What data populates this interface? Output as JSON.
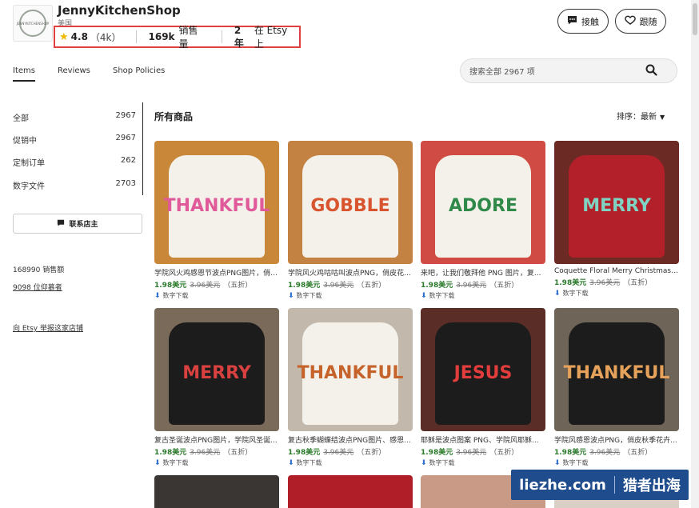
{
  "shop": {
    "name": "JennyKitchenShop",
    "location": "美国",
    "logo_text": "JENNYKITCHENSHOP",
    "rating": "4.8",
    "review_count": "（4k）",
    "sales": "169k",
    "sales_label": "销售量",
    "years": "2年",
    "years_label": "在 Etsy 上"
  },
  "header_buttons": {
    "contact": "接触",
    "follow": "跟随"
  },
  "tabs": [
    {
      "label": "Items"
    },
    {
      "label": "Reviews"
    },
    {
      "label": "Shop Policies"
    }
  ],
  "search": {
    "placeholder": "搜索全部 2967 项"
  },
  "sidebar": {
    "items": [
      {
        "label": "全部",
        "count": "2967"
      },
      {
        "label": "促销中",
        "count": "2967"
      },
      {
        "label": "定制订单",
        "count": "262"
      },
      {
        "label": "数字文件",
        "count": "2703"
      }
    ],
    "contact_owner": "联系店主",
    "sales_count": "168990 销售额",
    "admirers": "9098 位仰慕者",
    "report": "向 Etsy 举报这家店铺"
  },
  "main": {
    "title": "所有商品",
    "sort_label": "排序：最新"
  },
  "products": [
    {
      "title": "学院风火鸡感恩节波点PNG图片，俏皮...",
      "price": "1.98美元",
      "orig": "3.96美元",
      "discount": "（五折）",
      "download": "数字下载",
      "art": "THANKFUL",
      "bg": "#c9873a",
      "shirt": "light",
      "color": "#e05a9a"
    },
    {
      "title": "学院风火鸡咕咕叫波点PNG，俏皮花...",
      "price": "1.98美元",
      "orig": "3.96美元",
      "discount": "（五折）",
      "download": "数字下载",
      "art": "GOBBLE",
      "bg": "#c38242",
      "shirt": "light",
      "color": "#d8552f"
    },
    {
      "title": "来吧，让我们敬拜他 PNG 图片，复...",
      "price": "1.98美元",
      "orig": "3.96美元",
      "discount": "（五折）",
      "download": "数字下载",
      "art": "ADORE",
      "bg": "#cf4b43",
      "shirt": "light",
      "color": "#2f8a4a"
    },
    {
      "title": "Coquette Floral Merry Christmas Pn...",
      "price": "1.98美元",
      "orig": "3.96美元",
      "discount": "（五折）",
      "download": "数字下载",
      "art": "MERRY",
      "bg": "#6b2a23",
      "shirt": "red",
      "color": "#7fd3c2"
    },
    {
      "title": "复古圣诞波点PNG图片，学院风圣诞...",
      "price": "1.98美元",
      "orig": "3.96美元",
      "discount": "（五折）",
      "download": "数字下载",
      "art": "MERRY",
      "bg": "#7a6a5a",
      "shirt": "dark",
      "color": "#d94040"
    },
    {
      "title": "复古秋季蝴蝶结波点PNG图片、感恩...",
      "price": "1.98美元",
      "orig": "3.96美元",
      "discount": "（五折）",
      "download": "数字下载",
      "art": "THANKFUL",
      "bg": "#c2b8ab",
      "shirt": "light",
      "color": "#c5632a"
    },
    {
      "title": "耶稣是波点图案 PNG、学院风耶稣...",
      "price": "1.98美元",
      "orig": "3.96美元",
      "discount": "（五折）",
      "download": "数字下载",
      "art": "JESUS",
      "bg": "#5a2e26",
      "shirt": "dark",
      "color": "#e23c3c"
    },
    {
      "title": "学院风感恩波点PNG，俏皮秋季花卉...",
      "price": "1.98美元",
      "orig": "3.96美元",
      "discount": "（五折）",
      "download": "数字下载",
      "art": "THANKFUL",
      "bg": "#6e6458",
      "shirt": "dark",
      "color": "#e6a25a"
    }
  ],
  "watermark": {
    "left": "liezhe.com",
    "right": "猎者出海"
  },
  "colors": {
    "price": "#2b7a2b",
    "highlight_box": "#e2403e",
    "star": "#f0b800"
  }
}
